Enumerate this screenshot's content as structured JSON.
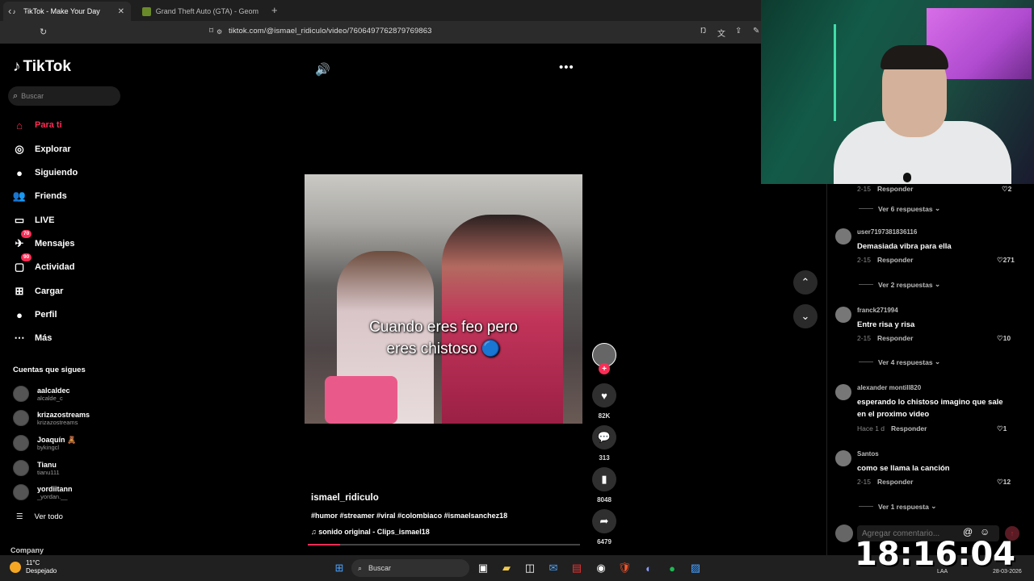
{
  "browser": {
    "tabs": [
      {
        "label": "TikTok - Make Your Day",
        "active": true
      },
      {
        "label": "Grand Theft Auto (GTA) - Geometry I",
        "active": false
      }
    ],
    "url": "tiktok.com/@ismael_ridiculo/video/7606497762879769863"
  },
  "sidebar": {
    "logo": "TikTok",
    "search_placeholder": "Buscar",
    "items": [
      {
        "label": "Para ti",
        "icon": "home-icon",
        "glyph": "⌂",
        "active": true
      },
      {
        "label": "Explorar",
        "icon": "compass-icon",
        "glyph": "◎"
      },
      {
        "label": "Siguiendo",
        "icon": "following-avatar-icon",
        "glyph": "●"
      },
      {
        "label": "Friends",
        "icon": "friends-icon",
        "glyph": "👥"
      },
      {
        "label": "LIVE",
        "icon": "live-icon",
        "glyph": "▭"
      },
      {
        "label": "Mensajes",
        "icon": "messages-icon",
        "glyph": "✈",
        "badge": "70"
      },
      {
        "label": "Actividad",
        "icon": "activity-icon",
        "glyph": "▢",
        "badge": "90"
      },
      {
        "label": "Cargar",
        "icon": "upload-icon",
        "glyph": "⊞"
      },
      {
        "label": "Perfil",
        "icon": "profile-icon",
        "glyph": "●"
      },
      {
        "label": "Más",
        "icon": "more-icon",
        "glyph": "⋯"
      }
    ],
    "following_title": "Cuentas que sigues",
    "following": [
      {
        "name": "aalcaldec",
        "handle": "alcalde_c"
      },
      {
        "name": "krizazostreams",
        "handle": "krizazostreams"
      },
      {
        "name": "Joaquín 🧸",
        "handle": "bykingcl"
      },
      {
        "name": "Tianu",
        "handle": "tianu111"
      },
      {
        "name": "yordiitann",
        "handle": "_yordan.__"
      }
    ],
    "see_all": "Ver todo",
    "company": "Company"
  },
  "video": {
    "caption_line1": "Cuando eres feo pero",
    "caption_line2": "eres chistoso 🔵",
    "author": "ismael_ridiculo",
    "tags": "#humor #streamer #viral #colombiaco #ismaelsanchez18",
    "sound": "sonido original - Clips_ismael18",
    "progress": 0.12
  },
  "actions": {
    "likes": "82K",
    "comments": "313",
    "saves": "8048",
    "shares": "6479"
  },
  "comments": {
    "top_partial": {
      "meta": "2-15",
      "reply": "Responder",
      "likes": "2",
      "replies": "Ver 6 respuestas"
    },
    "items": [
      {
        "user": "user7197381836116",
        "text": "Demasiada vibra para ella",
        "meta": "2-15",
        "reply": "Responder",
        "likes": "271",
        "replies": "Ver 2 respuestas"
      },
      {
        "user": "franck271994",
        "text": "Entre risa y risa",
        "meta": "2-15",
        "reply": "Responder",
        "likes": "10",
        "replies": "Ver 4 respuestas"
      },
      {
        "user": "alexander montill820",
        "text": "esperando lo chistoso imagino que sale en el proximo video",
        "meta": "Hace 1 d",
        "reply": "Responder",
        "likes": "1",
        "replies": ""
      },
      {
        "user": "Santos",
        "text": "como se llama la canción",
        "meta": "2-15",
        "reply": "Responder",
        "likes": "12",
        "replies": "Ver 1 respuesta"
      }
    ],
    "input_placeholder": "Agregar comentario..."
  },
  "taskbar": {
    "temp": "11°C",
    "weather": "Despejado",
    "search": "Buscar",
    "clock_overlay": "18:16:04",
    "lang": "LAA",
    "date": "28-03-2026"
  },
  "colors": {
    "accent": "#fe2c55"
  }
}
